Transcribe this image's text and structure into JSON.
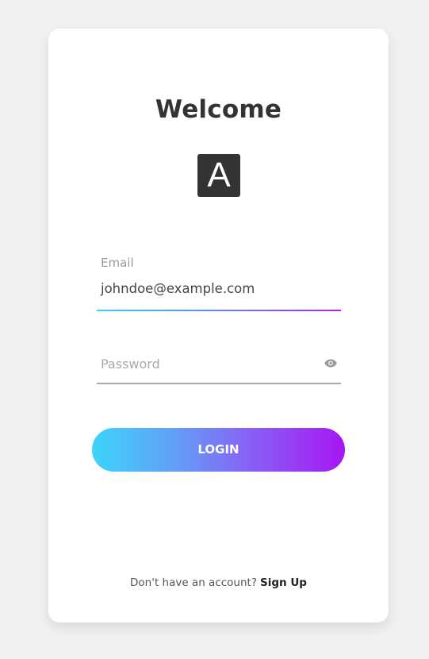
{
  "header": {
    "title": "Welcome",
    "logo_letter": "A"
  },
  "form": {
    "email": {
      "label": "Email",
      "value": "johndoe@example.com"
    },
    "password": {
      "placeholder": "Password",
      "toggle_icon": "eye-icon"
    },
    "login_label": "LOGIN"
  },
  "footer": {
    "prompt": "Don't have an account?",
    "signup_label": "Sign Up"
  },
  "colors": {
    "background": "#f1f1f1",
    "card": "#ffffff",
    "title": "#333333",
    "gradient_start": "#3dd4fb",
    "gradient_end": "#a716f3"
  }
}
